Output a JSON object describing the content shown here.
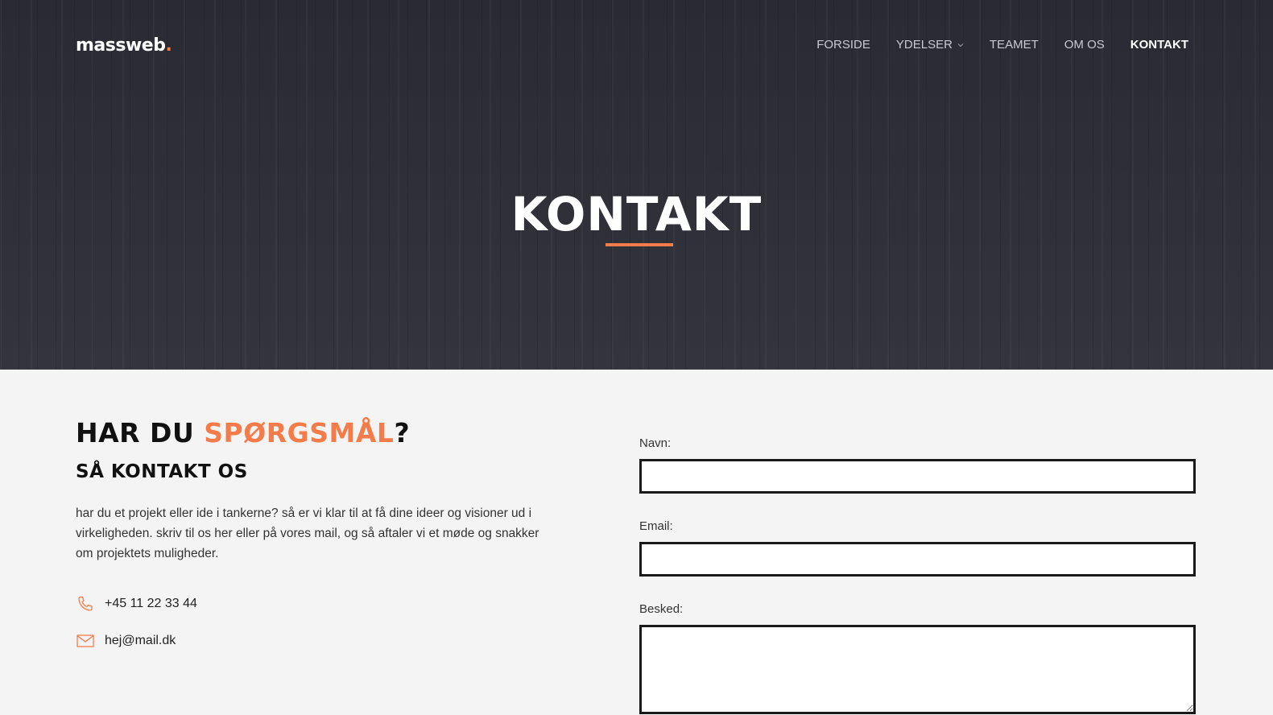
{
  "header": {
    "logo_text": "massweb",
    "logo_dot": ".",
    "nav": [
      {
        "label": "FORSIDE"
      },
      {
        "label": "YDELSER"
      },
      {
        "label": "TEAMET"
      },
      {
        "label": "OM OS"
      },
      {
        "label": "KONTAKT"
      }
    ],
    "active_item": "KONTAKT"
  },
  "hero": {
    "title": "KONTAKT"
  },
  "contact": {
    "heading_prefix": "HAR DU ",
    "heading_accent": "SPØRGSMÅL",
    "heading_suffix": "?",
    "subheading": "SÅ KONTAKT OS",
    "intro": "har du et projekt eller ide i tankerne? så er vi klar til at få dine ideer og visioner ud i virkeligheden. skriv til os her eller på vores mail, og så aftaler vi et møde og snakker om projektets muligheder.",
    "phone": "+45 11 22 33 44",
    "email": "hej@mail.dk"
  },
  "form": {
    "name_label": "Navn:",
    "name_value": "",
    "email_label": "Email:",
    "email_value": "",
    "message_label": "Besked:",
    "message_value": ""
  },
  "icons": {
    "phone": "phone-icon",
    "mail": "mail-icon",
    "dropdown": "chevron-down-icon"
  },
  "colors": {
    "accent": "#f47c4a",
    "hero_bg": "#2d2d35",
    "page_bg": "#f4f4f4",
    "text_dark": "#111111"
  }
}
